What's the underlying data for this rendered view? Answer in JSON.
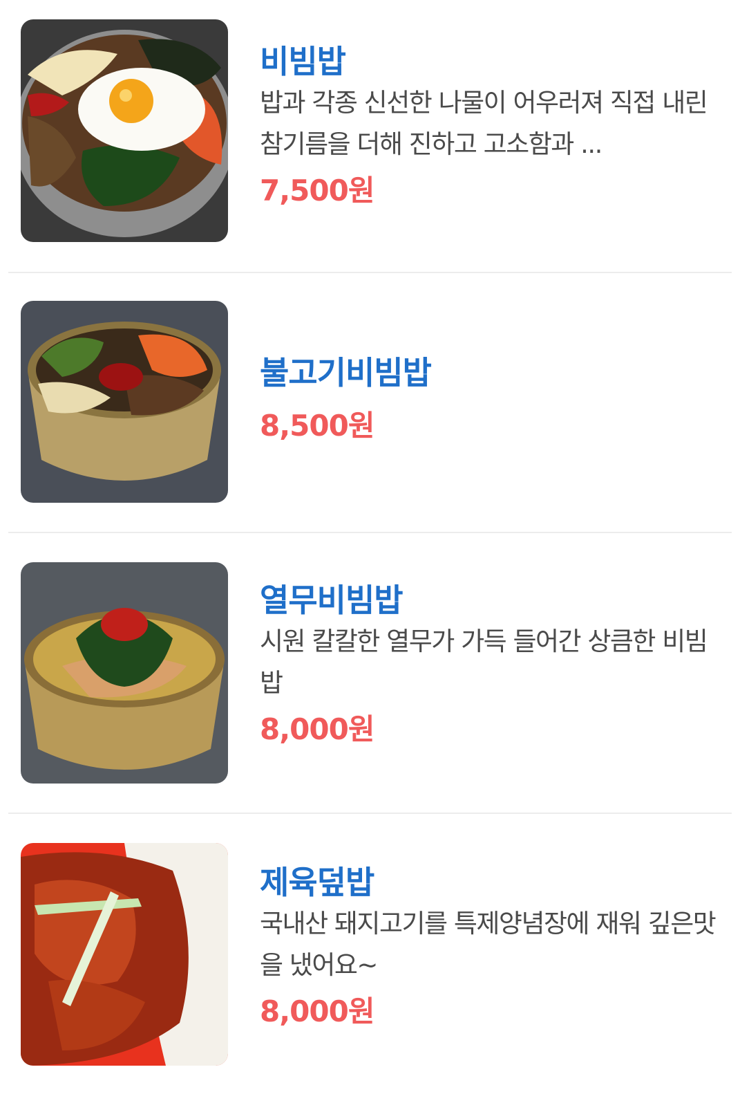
{
  "menu": {
    "items": [
      {
        "name": "비빔밥",
        "description": "밥과 각종 신선한 나물이 어우러져 직접 내린 참기름을 더해 진하고 고소함과 ...",
        "price": "7,500원"
      },
      {
        "name": "불고기비빔밥",
        "description": "",
        "price": "8,500원"
      },
      {
        "name": "열무비빔밥",
        "description": "시원 칼칼한 열무가 가득 들어간 상큼한 비빔밥",
        "price": "8,000원"
      },
      {
        "name": "제육덮밥",
        "description": "국내산 돼지고기를 특제양념장에 재워 깊은맛을 냈어요~",
        "price": "8,000원"
      }
    ]
  },
  "colors": {
    "name": "#1f6fc9",
    "price": "#f05a5a",
    "description": "#4a4a4a",
    "divider": "#ececec"
  }
}
